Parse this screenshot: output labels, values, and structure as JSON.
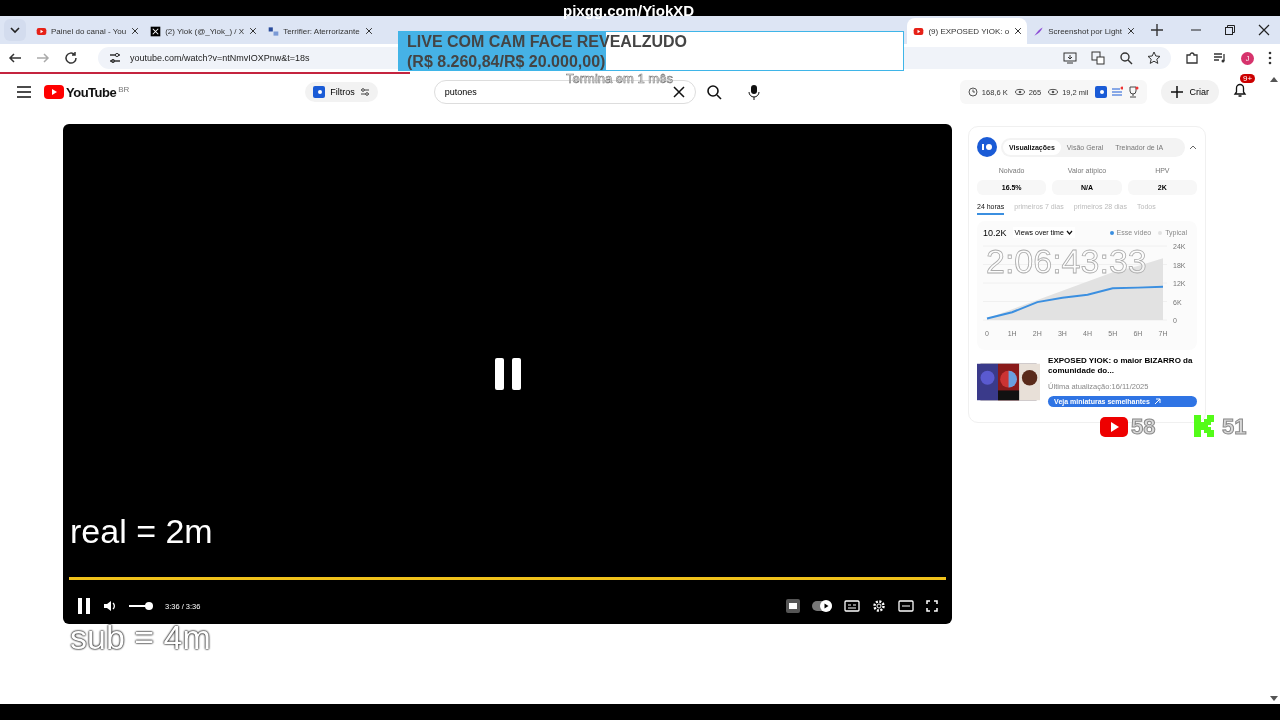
{
  "tabs": [
    {
      "kind": "youtube",
      "title": "Painel do canal - You",
      "selected": false
    },
    {
      "kind": "x",
      "title": "(2) Yiok (@_Yiok_) / X",
      "selected": false
    },
    {
      "kind": "site",
      "title": "Terrifier: Aterrorizante",
      "selected": false
    },
    {
      "kind": "youtube",
      "title": "(9) EXPOSED YIOK: o",
      "selected": true
    },
    {
      "kind": "feather",
      "title": "Screenshot por Light",
      "selected": false
    }
  ],
  "address": "youtube.com/watch?v=ntNmvIOXPnw&t=18s",
  "profile_initial": "J",
  "header": {
    "logo_text": "YouTube",
    "region": "BR",
    "filter_label": "Filtros",
    "search_value": "putones",
    "stats": [
      "168,6 K",
      "265",
      "19,2 mil"
    ],
    "create_label": "Criar",
    "notifications": "9+"
  },
  "player": {
    "time": "3:36 / 3:36",
    "progress": {
      "level": 1
    },
    "volume": {
      "level": 0.85
    }
  },
  "panel": {
    "tabs": [
      {
        "label": "Visualizações",
        "selected": true
      },
      {
        "label": "Visão Geral",
        "selected": false
      },
      {
        "label": "Treinador de IA",
        "selected": false
      }
    ],
    "metrics": [
      {
        "label": "Noivado",
        "value": "16.5%"
      },
      {
        "label": "Valor atípico",
        "value": "N/A"
      },
      {
        "label": "HPV",
        "value": "2K"
      }
    ],
    "periods": [
      {
        "label": "24 horas",
        "selected": true
      },
      {
        "label": "primeiros 7 dias",
        "selected": false
      },
      {
        "label": "primeiros 28 dias",
        "selected": false
      },
      {
        "label": "Todos",
        "selected": false
      }
    ],
    "total": "10.2K",
    "metric_select": "Views over time",
    "chart_data": {
      "type": "line",
      "grid": true,
      "x": [
        "0",
        "1H",
        "2H",
        "3H",
        "4H",
        "5H",
        "6H",
        "7H"
      ],
      "ylim": [
        0,
        24000
      ],
      "yticks": [
        {
          "value": 0,
          "label": "0"
        },
        {
          "value": 6000,
          "label": "6K"
        },
        {
          "value": 12000,
          "label": "12K"
        },
        {
          "value": 18000,
          "label": "18K"
        },
        {
          "value": 24000,
          "label": "24K"
        }
      ],
      "series": [
        {
          "name": "Esse vídeo",
          "color": "#3b8fe0",
          "values": [
            500,
            2500,
            5800,
            7200,
            8200,
            10300,
            10500,
            10800
          ]
        },
        {
          "name": "Typical",
          "type": "area",
          "color": "#e2e2e2",
          "values": [
            500,
            3500,
            6500,
            9500,
            12500,
            15500,
            17500,
            20000
          ]
        }
      ]
    },
    "video": {
      "title": "EXPOSED YIOK: o maior BIZARRO da comunidade do...",
      "updated": "Última atualização:16/11/2025",
      "button": "Veja miniaturas semelhantes"
    }
  },
  "overlay": {
    "banner": "pixgg.com/YiokXD",
    "goal_title": "LIVE COM CAM FACE REVEALZUDO",
    "goal_amount": "(R$ 8.260,84/R$ 20.000,00)",
    "goal": {
      "level": 0.41
    },
    "goal_ends": "Termina em 1 mês",
    "countdown": "2:06:43:33",
    "youtube_count": "58",
    "kick_count": "51",
    "caption_top": "real = 2m",
    "caption_bottom": "sub = 4m"
  }
}
